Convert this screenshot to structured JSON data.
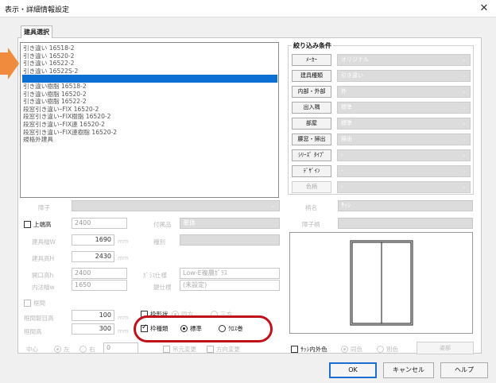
{
  "window": {
    "title": "表示・詳細情報設定",
    "close_icon": "close-icon"
  },
  "tab": {
    "label": "建具選択"
  },
  "list": {
    "items": [
      "引き違い 16518-2",
      "引き違い 16520-2",
      "引き違い 16522-2",
      "引き違い 16522S-2",
      "",
      "引き違い樹脂 16518-2",
      "引き違い樹脂 16520-2",
      "引き違い樹脂 16522-2",
      "段窓引き違いｰFIX 16520-2",
      "段窓引き違いｰFIX樹脂 16520-2",
      "段窓引き違いｰFIX連 16520-2",
      "段窓引き違いｰFIX連樹脂 16520-2",
      "規格外建具"
    ],
    "selected_index": 4
  },
  "filter": {
    "title": "絞り込み条件",
    "rows": [
      {
        "button": "ﾒｰｶｰ",
        "value": "オリジナル",
        "enabled": true
      },
      {
        "button": "建具種類",
        "value": "引き違い",
        "enabled": true
      },
      {
        "button": "内部・外部",
        "value": "外",
        "enabled": true
      },
      {
        "button": "出入隅",
        "value": "標準",
        "enabled": true
      },
      {
        "button": "部屋",
        "value": "標準",
        "enabled": true
      },
      {
        "button": "腰窓・掃出",
        "value": "掃出",
        "enabled": true
      },
      {
        "button": "ｼﾘｰｽﾞ ﾀｲﾌﾟ",
        "value": "-",
        "enabled": true
      },
      {
        "button": "ﾃﾞｻﾞｲﾝ",
        "value": "-",
        "enabled": true
      },
      {
        "button": "色柄",
        "value": "-",
        "enabled": false
      }
    ]
  },
  "form": {
    "shoji_label": "障子",
    "joshaku_label": "上端高",
    "joshaku_value": "2400",
    "fuzoku_label": "付属品",
    "fuzoku_value": "単体",
    "width_label": "建具幅W",
    "width_value": "1690",
    "shubetsu_label": "種別",
    "height_label": "建具高H",
    "height_value": "2430",
    "opening_h_label": "開口高h",
    "opening_h_value": "2400",
    "glass_label": "ｶﾞﾗｽ仕様",
    "glass_value": "Low-E複層ｶﾞﾗｽ",
    "inner_w_label": "内法幅w",
    "inner_w_value": "1650",
    "kagi_label": "鍵仕様",
    "kagi_value": "(未設定)",
    "unit": "mm",
    "kamachi_label": "框間",
    "kamachi_chiri_label": "框間躯目高",
    "kamachi_chiri_value": "100",
    "kamachi_high_label": "框間高",
    "kamachi_high_value": "300",
    "waku_label": "枠形状",
    "shiho_label": "四方",
    "sanpo_label": "三方",
    "waku_kind_label": "枠種類",
    "hyojun_label": "標準",
    "kuromaki_label": "ｸﾛｽ巻",
    "center_label": "中心",
    "left_label": "左",
    "right_label": "右",
    "offset_value": "0",
    "tsuri_label": "吊元変更",
    "houkou_label": "方向変更",
    "gara_label": "柄名",
    "gara_value": "ｻｯｼ",
    "shoji_gara_label": "障子柄",
    "sash_color_label": "ｻｯｼ内外色",
    "same_color_label": "同色",
    "diff_color_label": "別色",
    "color_button": "姿部"
  },
  "buttons": {
    "ok": "OK",
    "cancel": "キャンセル",
    "help": "ヘルプ"
  },
  "colors": {
    "selection": "#0b6fd4",
    "highlight_oval": "#c0101a",
    "arrow": "#f08a3c"
  }
}
